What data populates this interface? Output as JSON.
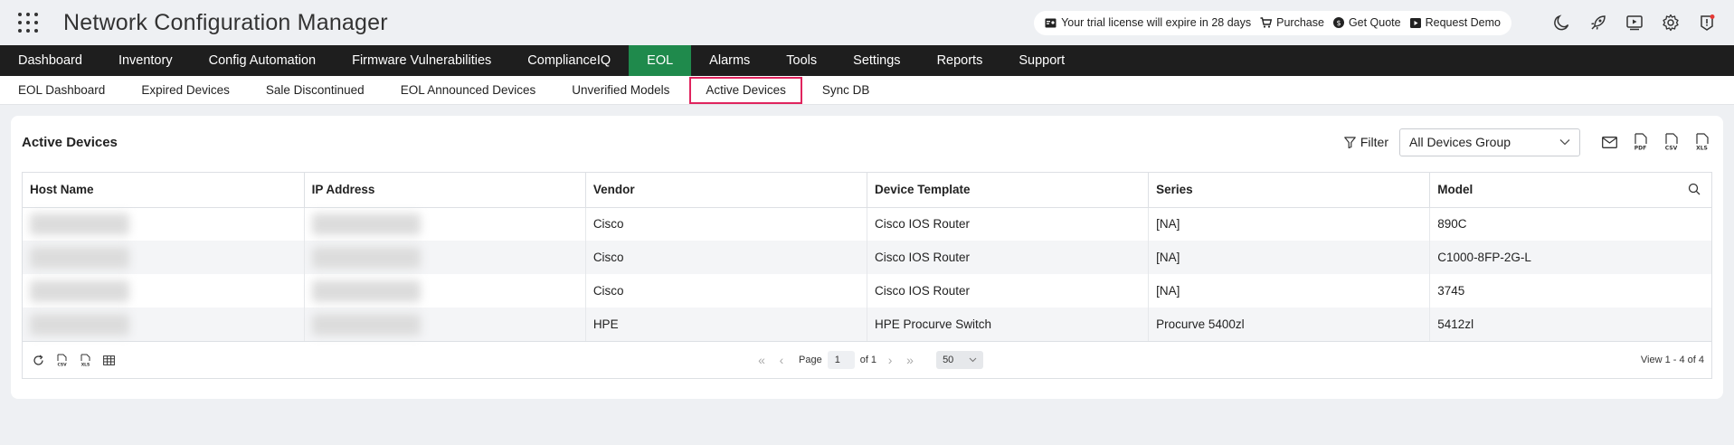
{
  "app": {
    "title": "Network Configuration Manager"
  },
  "trial": {
    "message": "Your trial license will expire in 28 days",
    "purchase": "Purchase",
    "get_quote": "Get Quote",
    "request_demo": "Request Demo"
  },
  "main_nav": {
    "items": [
      {
        "label": "Dashboard"
      },
      {
        "label": "Inventory"
      },
      {
        "label": "Config Automation"
      },
      {
        "label": "Firmware Vulnerabilities"
      },
      {
        "label": "ComplianceIQ"
      },
      {
        "label": "EOL"
      },
      {
        "label": "Alarms"
      },
      {
        "label": "Tools"
      },
      {
        "label": "Settings"
      },
      {
        "label": "Reports"
      },
      {
        "label": "Support"
      }
    ],
    "active": "EOL"
  },
  "sub_nav": {
    "items": [
      {
        "label": "EOL Dashboard"
      },
      {
        "label": "Expired Devices"
      },
      {
        "label": "Sale Discontinued"
      },
      {
        "label": "EOL Announced Devices"
      },
      {
        "label": "Unverified Models"
      },
      {
        "label": "Active Devices"
      },
      {
        "label": "Sync DB"
      }
    ],
    "active": "Active Devices"
  },
  "panel": {
    "title": "Active Devices",
    "filter_label": "Filter",
    "group_select": "All Devices Group"
  },
  "table": {
    "columns": [
      "Host Name",
      "IP Address",
      "Vendor",
      "Device Template",
      "Series",
      "Model"
    ],
    "rows": [
      {
        "vendor": "Cisco",
        "template": "Cisco IOS Router",
        "series": "[NA]",
        "model": "890C"
      },
      {
        "vendor": "Cisco",
        "template": "Cisco IOS Router",
        "series": "[NA]",
        "model": "C1000-8FP-2G-L"
      },
      {
        "vendor": "Cisco",
        "template": "Cisco IOS Router",
        "series": "[NA]",
        "model": "3745"
      },
      {
        "vendor": "HPE",
        "template": "HPE Procurve Switch",
        "series": "Procurve 5400zl",
        "model": "5412zl"
      }
    ]
  },
  "footer": {
    "page_label": "Page",
    "page_value": "1",
    "of_label": "of 1",
    "per_page": "50",
    "view_info": "View 1 - 4 of 4"
  },
  "colors": {
    "nav_bg": "#1e1e1e",
    "nav_active": "#1f8a4c",
    "sub_active_border": "#e0245e"
  }
}
